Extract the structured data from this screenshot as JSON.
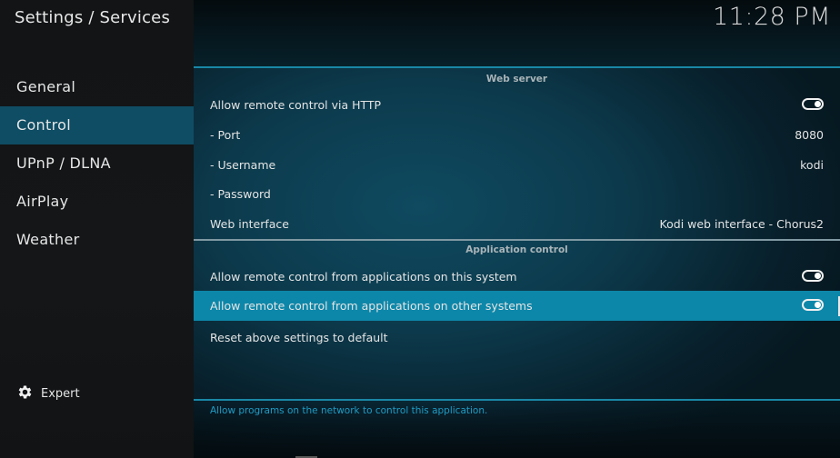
{
  "header": {
    "title": "Settings / Services",
    "clock": "11:28 PM"
  },
  "sidebar": {
    "items": [
      {
        "label": "General",
        "active": false
      },
      {
        "label": "Control",
        "active": true
      },
      {
        "label": "UPnP / DLNA",
        "active": false
      },
      {
        "label": "AirPlay",
        "active": false
      },
      {
        "label": "Weather",
        "active": false
      }
    ],
    "expert": {
      "label": "Expert",
      "icon": "gear-icon"
    }
  },
  "sections": {
    "web_server": {
      "title": "Web server",
      "rows": [
        {
          "label": "Allow remote control via HTTP",
          "type": "toggle",
          "value": true
        },
        {
          "label": "- Port",
          "type": "value",
          "value": "8080"
        },
        {
          "label": "- Username",
          "type": "value",
          "value": "kodi"
        },
        {
          "label": "- Password",
          "type": "value",
          "value": ""
        },
        {
          "label": "Web interface",
          "type": "value",
          "value": "Kodi web interface - Chorus2"
        }
      ]
    },
    "application_control": {
      "title": "Application control",
      "rows": [
        {
          "label": "Allow remote control from applications on this system",
          "type": "toggle",
          "value": true
        },
        {
          "label": "Allow remote control from applications on other systems",
          "type": "toggle",
          "value": true,
          "focused": true
        },
        {
          "label": "Reset above settings to default",
          "type": "action"
        }
      ]
    }
  },
  "help_text": "Allow programs on the network to control this application.",
  "colors": {
    "accent": "#1a87a6",
    "focus_row": "#0d87a9",
    "sidebar_active": "#0f4d64",
    "help_text": "#1f9bc4"
  }
}
